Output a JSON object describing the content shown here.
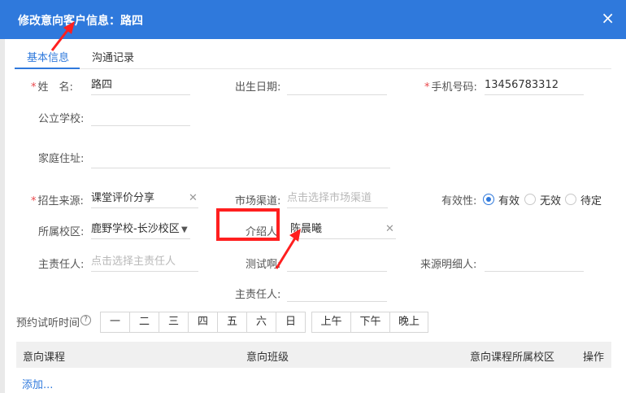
{
  "dialog": {
    "title": "修改意向客户信息：路四",
    "close_icon": "×"
  },
  "tabs": [
    "基本信息",
    "沟通记录"
  ],
  "form": {
    "name": {
      "label": "姓　名:",
      "value": "路四"
    },
    "birth": {
      "label": "出生日期:",
      "value": ""
    },
    "phone": {
      "label": "手机号码:",
      "value": "13456783312"
    },
    "school": {
      "label": "公立学校:",
      "value": ""
    },
    "address": {
      "label": "家庭住址:",
      "value": ""
    },
    "source": {
      "label": "招生来源:",
      "value": "课堂评价分享"
    },
    "channel": {
      "label": "市场渠道:",
      "placeholder": "点击选择市场渠道"
    },
    "validity": {
      "label": "有效性:",
      "options": [
        "有效",
        "无效",
        "待定"
      ],
      "selected": "有效"
    },
    "campus": {
      "label": "所属校区:",
      "value": "鹿野学校-长沙校区"
    },
    "referrer": {
      "label": "介绍人:",
      "value": "陈晨曦"
    },
    "owner": {
      "label": "主责任人:",
      "placeholder": "点击选择主责任人"
    },
    "test": {
      "label": "测试啊:",
      "value": ""
    },
    "source_detail": {
      "label": "来源明细人:",
      "value": ""
    },
    "owner2": {
      "label": "主责任人:",
      "value": ""
    }
  },
  "trial": {
    "label": "预约试听时间",
    "help_icon": "?",
    "days": [
      "一",
      "二",
      "三",
      "四",
      "五",
      "六",
      "日"
    ],
    "periods": [
      "上午",
      "下午",
      "晚上"
    ]
  },
  "table": {
    "headers": [
      "意向课程",
      "意向班级",
      "意向课程所属校区",
      "操作"
    ],
    "add_link": "添加..."
  },
  "colors": {
    "accent": "#2f79dc",
    "required": "#e9474b",
    "annotation": "#ff1f1f"
  }
}
